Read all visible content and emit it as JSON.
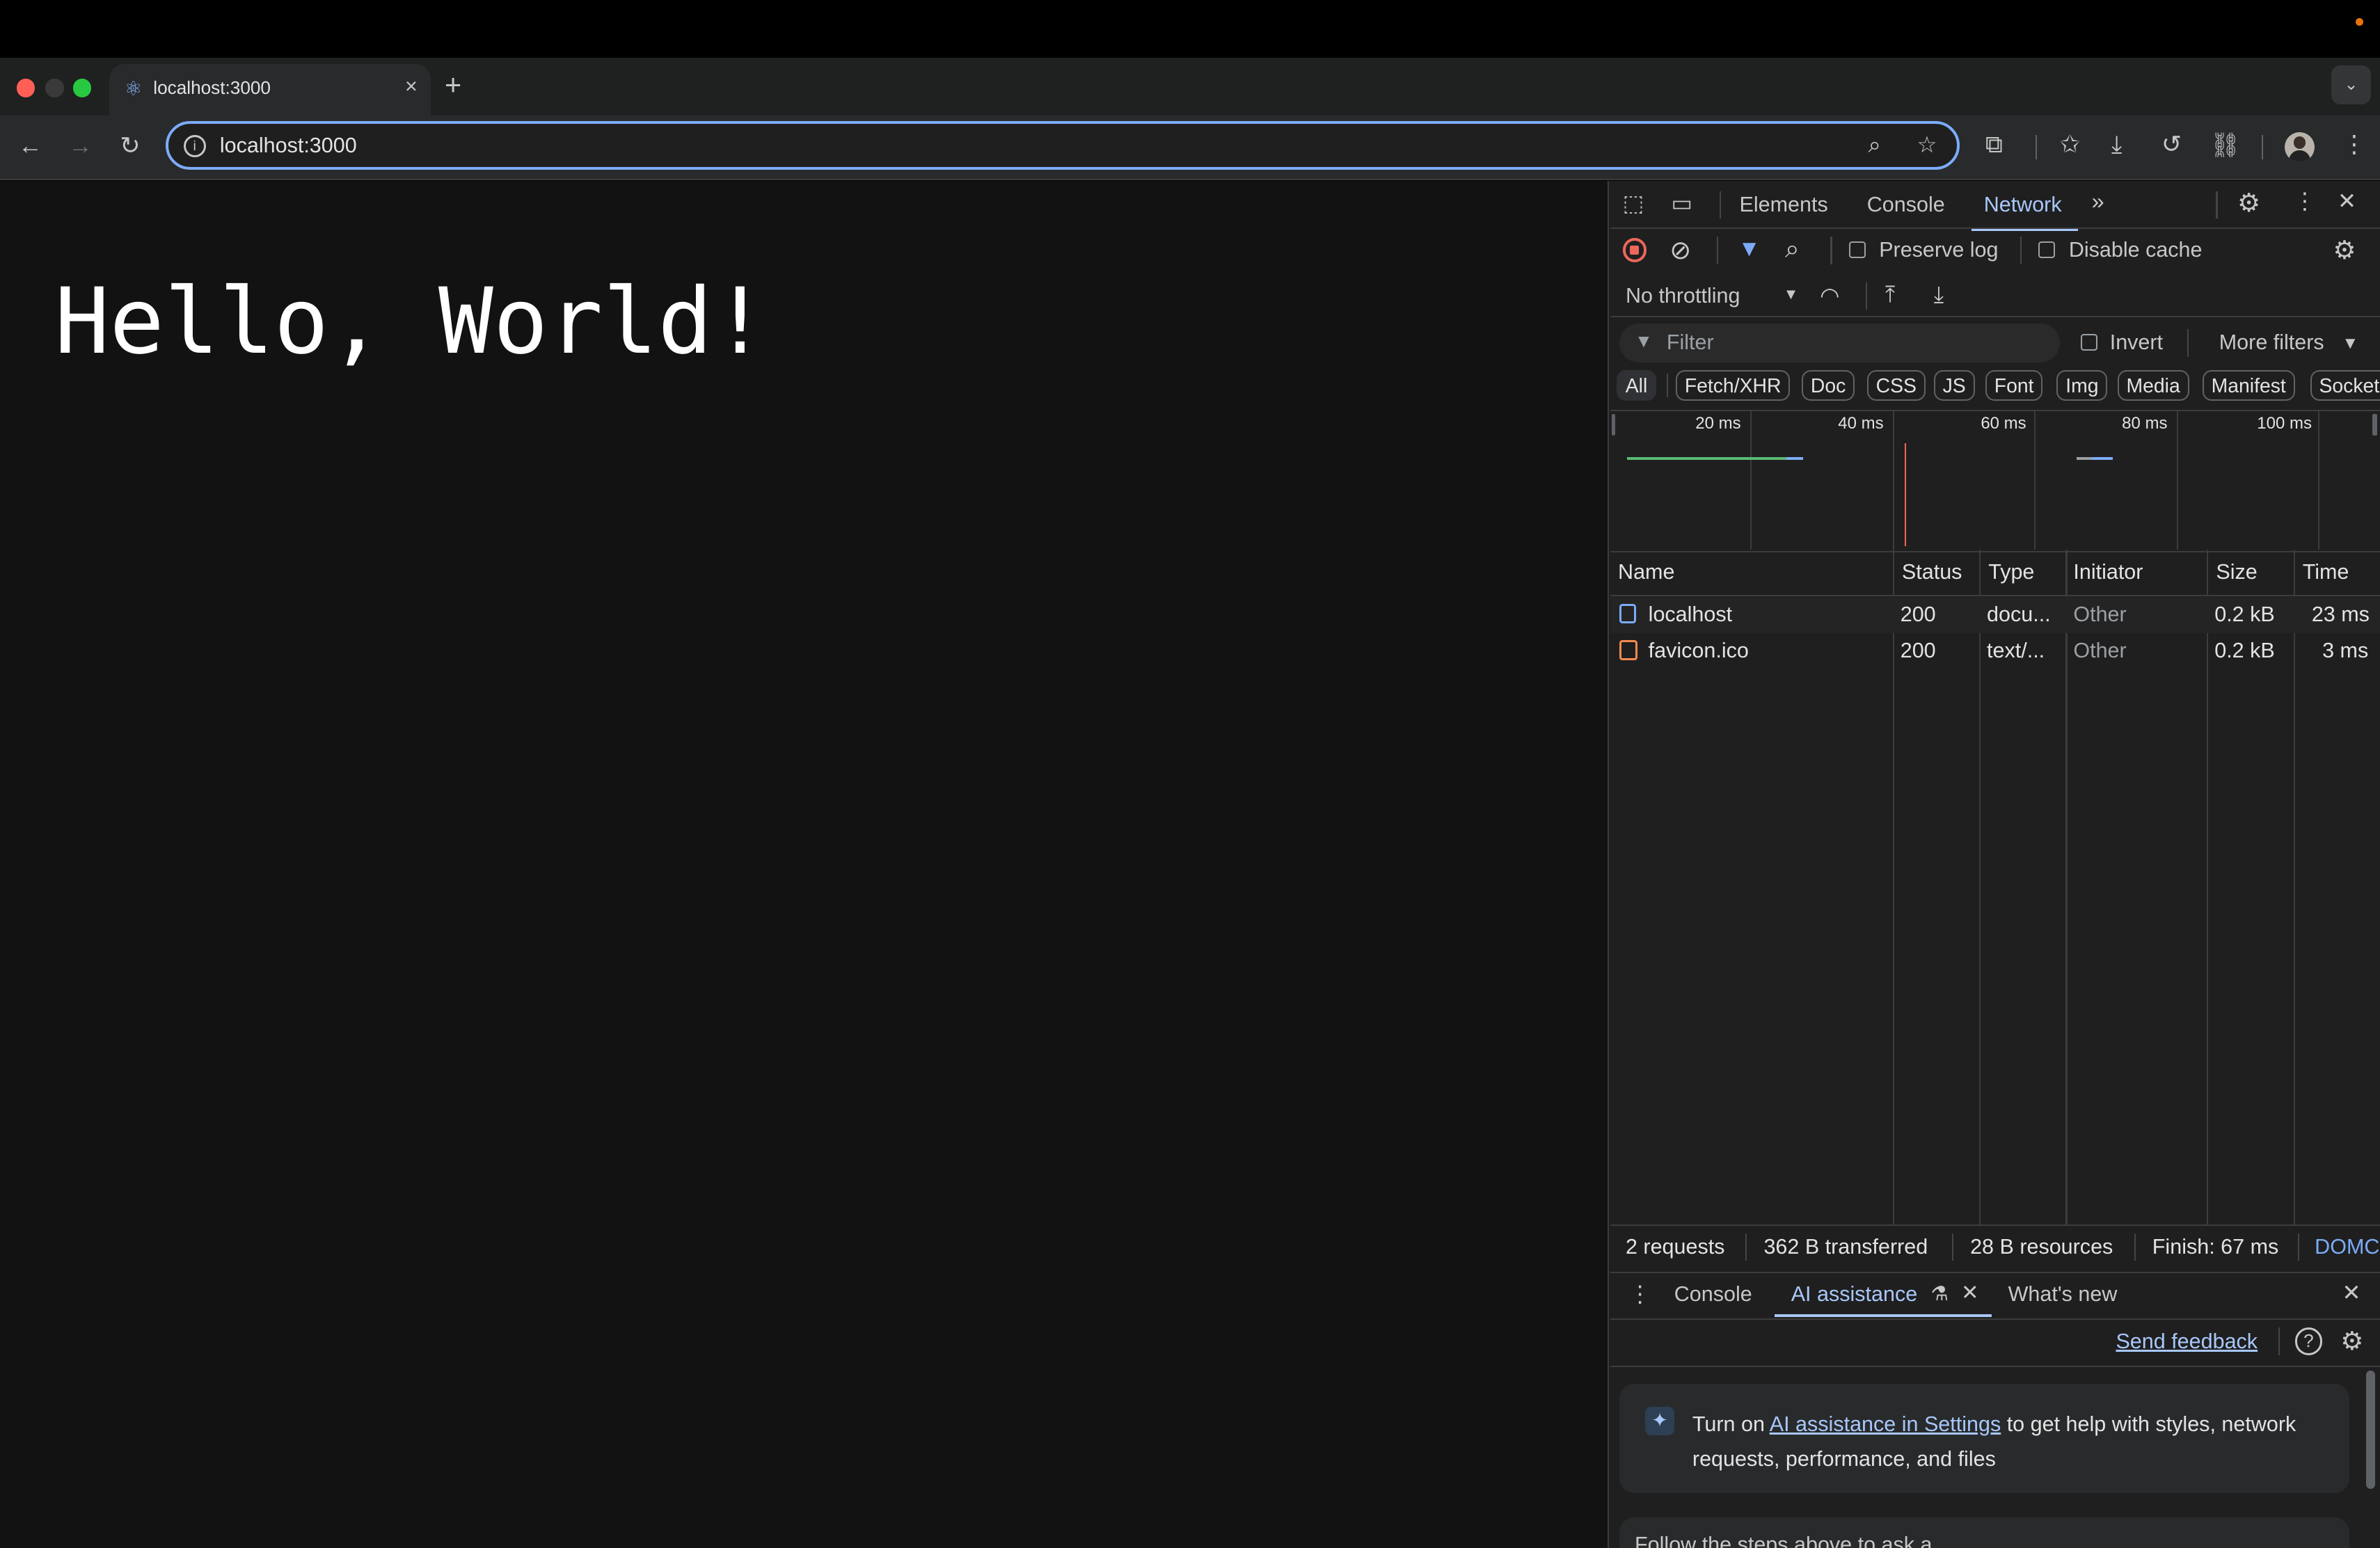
{
  "browser": {
    "tab_title": "localhost:3000",
    "url": "localhost:3000",
    "new_tab": "+",
    "close_tab": "×"
  },
  "page": {
    "heading": "Hello, World!"
  },
  "devtools": {
    "tabs": [
      "Elements",
      "Console",
      "Network"
    ],
    "active_tab": "Network",
    "toolbar": {
      "preserve_log": "Preserve log",
      "disable_cache": "Disable cache",
      "throttling": "No throttling"
    },
    "filter": {
      "placeholder": "Filter",
      "invert": "Invert",
      "more_filters": "More filters"
    },
    "type_filters": [
      "All",
      "Fetch/XHR",
      "Doc",
      "CSS",
      "JS",
      "Font",
      "Img",
      "Media",
      "Manifest",
      "Socket"
    ],
    "overview_ticks": [
      "20 ms",
      "40 ms",
      "60 ms",
      "80 ms",
      "100 ms"
    ],
    "columns": [
      "Name",
      "Status",
      "Type",
      "Initiator",
      "Size",
      "Time"
    ],
    "requests": [
      {
        "name": "localhost",
        "status": "200",
        "type": "docu...",
        "initiator": "Other",
        "size": "0.2 kB",
        "time": "23 ms"
      },
      {
        "name": "favicon.ico",
        "status": "200",
        "type": "text/...",
        "initiator": "Other",
        "size": "0.2 kB",
        "time": "3 ms"
      }
    ],
    "status_bar": {
      "requests": "2 requests",
      "transferred": "362 B transferred",
      "resources": "28 B resources",
      "finish": "Finish: 67 ms",
      "domcontent": "DOMC"
    },
    "drawer": {
      "tabs": [
        "Console",
        "AI assistance",
        "What's new"
      ],
      "active_tab": "AI assistance",
      "send_feedback": "Send feedback",
      "card_prefix": "Turn on ",
      "card_link": "AI assistance in Settings",
      "card_suffix": " to get help with styles, network requests, performance, and files",
      "follow_text": "Follow the steps above to ask a"
    }
  },
  "colors": {
    "accent": "#a8c7fa",
    "record": "#ee675c",
    "omnibox_border": "#7cacf8"
  }
}
